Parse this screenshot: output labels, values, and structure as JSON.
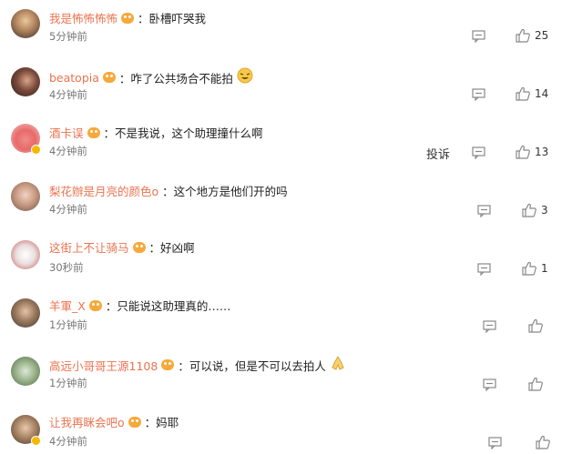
{
  "comments": [
    {
      "username": "我是怖怖怖怖",
      "text": "卧槽吓哭我",
      "time": "5分钟前",
      "likes": "25",
      "has_emoji": false,
      "report": ""
    },
    {
      "username": "beatopia",
      "text": "咋了公共场合不能拍",
      "time": "4分钟前",
      "likes": "14",
      "has_emoji": true,
      "report": ""
    },
    {
      "username": "酒卡误",
      "text": "不是我说，这个助理撞什么啊",
      "time": "4分钟前",
      "likes": "13",
      "has_emoji": false,
      "report": "投诉"
    },
    {
      "username": "梨花辦是月亮的颜色o",
      "text": "这个地方是他们开的吗",
      "time": "4分钟前",
      "likes": "3",
      "has_emoji": false,
      "report": ""
    },
    {
      "username": "这街上不让骑马",
      "text": "好凶啊",
      "time": "30秒前",
      "likes": "1",
      "has_emoji": false,
      "report": ""
    },
    {
      "username": "羊軍_X",
      "text": "只能说这助理真的……",
      "time": "1分钟前",
      "likes": "",
      "has_emoji": false,
      "report": ""
    },
    {
      "username": "高远小哥哥王源1108",
      "text": "可以说，但是不可以去拍人",
      "time": "1分钟前",
      "likes": "",
      "has_emoji": true,
      "report": ""
    },
    {
      "username": "让我再眯会吧o",
      "text": "妈耶",
      "time": "4分钟前",
      "likes": "",
      "has_emoji": false,
      "report": ""
    }
  ],
  "icons": {
    "fan_badge": "fan-badge-icon",
    "reply": "reply-icon",
    "like": "thumbs-up-icon"
  },
  "colors": {
    "username": "#eb7350",
    "text": "#222222",
    "meta": "#777777",
    "icon": "#888888",
    "badge": "#f6a93b"
  }
}
